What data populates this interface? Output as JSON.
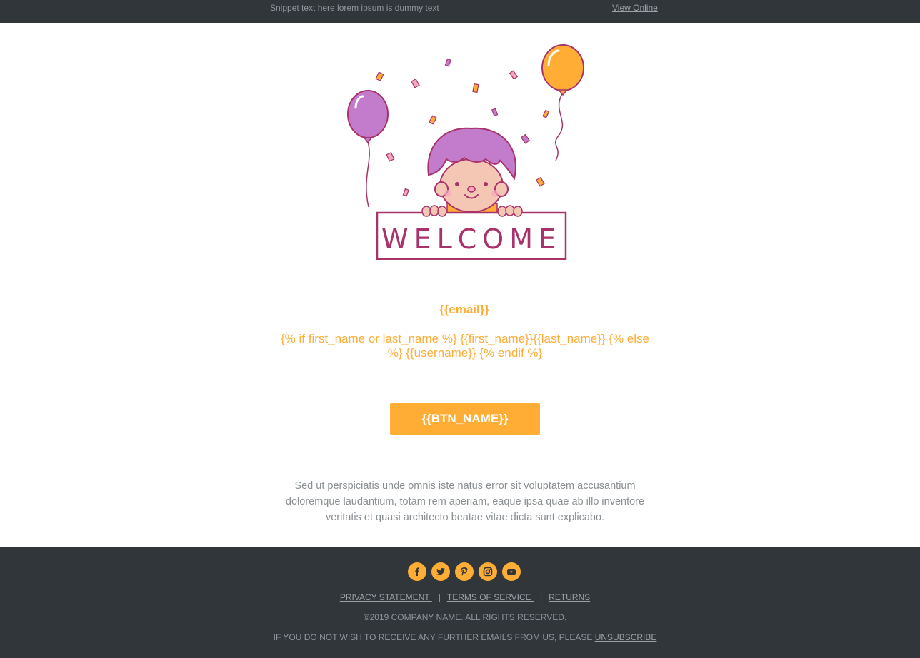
{
  "header": {
    "snippet": "Snippet text here lorem ipsum is dummy text",
    "view_online": "View Online"
  },
  "hero": {
    "sign_text": "WELCOME",
    "icons": [
      "balloon-icon",
      "confetti-icon",
      "child-illustration"
    ]
  },
  "content": {
    "email_var": "{{email}}",
    "name_var": "{% if first_name or last_name %} {{first_name}}{{last_name}} {% else %} {{username}} {% endif %}",
    "button_label": "{{BTN_NAME}}",
    "body_text": "Sed ut perspiciatis unde omnis iste natus error sit voluptatem accusantium doloremque laudantium, totam rem aperiam, eaque ipsa quae ab illo inventore veritatis et quasi architecto beatae vitae dicta sunt explicabo."
  },
  "footer": {
    "social": [
      "facebook-icon",
      "twitter-icon",
      "pinterest-icon",
      "instagram-icon",
      "youtube-icon"
    ],
    "links": [
      "PRIVACY STATEMENT ",
      "TERMS OF SERVICE ",
      "RETURNS"
    ],
    "separator": "|",
    "copyright": "©2019 COMPANY NAME. ALL RIGHTS RESERVED.",
    "unsubscribe_prefix": "IF YOU DO NOT WISH TO RECEIVE ANY FURTHER EMAILS FROM US, PLEASE ",
    "unsubscribe_link": "UNSUBSCRIBE"
  },
  "colors": {
    "accent": "#ffad35",
    "dark_bar": "#30363a",
    "hair": "#c37ccb",
    "outline": "#a8326a"
  }
}
